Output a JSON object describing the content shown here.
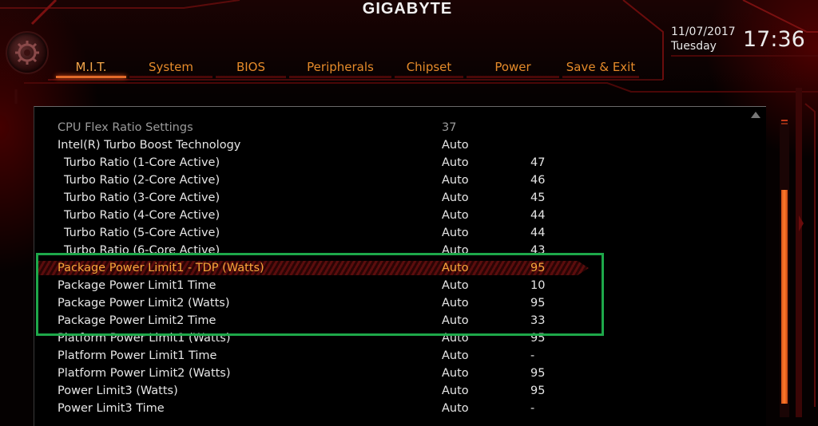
{
  "brand": "GIGABYTE",
  "nav": {
    "tabs": [
      {
        "label": "M.I.T.",
        "active": true
      },
      {
        "label": "System",
        "active": false
      },
      {
        "label": "BIOS",
        "active": false
      },
      {
        "label": "Peripherals",
        "active": false
      },
      {
        "label": "Chipset",
        "active": false
      },
      {
        "label": "Power",
        "active": false
      },
      {
        "label": "Save & Exit",
        "active": false
      }
    ]
  },
  "clock": {
    "date": "11/07/2017",
    "day": "Tuesday",
    "time": "17:36"
  },
  "colors": {
    "accent": "#e26a2a",
    "tab_text": "#e58a2a",
    "selected_text": "#f6a63a",
    "highlight_box": "#1ea84a"
  },
  "settings": [
    {
      "label": "CPU Flex Ratio Settings",
      "value": "37",
      "current": "",
      "indent": false,
      "dim": true,
      "selected": false
    },
    {
      "label": "Intel(R) Turbo Boost Technology",
      "value": "Auto",
      "current": "",
      "indent": false,
      "dim": false,
      "selected": false
    },
    {
      "label": "Turbo Ratio (1-Core Active)",
      "value": "Auto",
      "current": "47",
      "indent": true,
      "dim": false,
      "selected": false
    },
    {
      "label": "Turbo Ratio (2-Core Active)",
      "value": "Auto",
      "current": "46",
      "indent": true,
      "dim": false,
      "selected": false
    },
    {
      "label": "Turbo Ratio (3-Core Active)",
      "value": "Auto",
      "current": "45",
      "indent": true,
      "dim": false,
      "selected": false
    },
    {
      "label": "Turbo Ratio (4-Core Active)",
      "value": "Auto",
      "current": "44",
      "indent": true,
      "dim": false,
      "selected": false
    },
    {
      "label": "Turbo Ratio (5-Core Active)",
      "value": "Auto",
      "current": "44",
      "indent": true,
      "dim": false,
      "selected": false
    },
    {
      "label": "Turbo Ratio (6-Core Active)",
      "value": "Auto",
      "current": "43",
      "indent": true,
      "dim": false,
      "selected": false
    },
    {
      "label": "Package Power Limit1 - TDP (Watts)",
      "value": "Auto",
      "current": "95",
      "indent": false,
      "dim": false,
      "selected": true
    },
    {
      "label": "Package Power Limit1 Time",
      "value": "Auto",
      "current": "10",
      "indent": false,
      "dim": false,
      "selected": false
    },
    {
      "label": "Package Power Limit2 (Watts)",
      "value": "Auto",
      "current": "95",
      "indent": false,
      "dim": false,
      "selected": false
    },
    {
      "label": "Package Power Limit2 Time",
      "value": "Auto",
      "current": "33",
      "indent": false,
      "dim": false,
      "selected": false
    },
    {
      "label": "Platform Power Limit1 (Watts)",
      "value": "Auto",
      "current": "95",
      "indent": false,
      "dim": false,
      "selected": false
    },
    {
      "label": "Platform Power Limit1 Time",
      "value": "Auto",
      "current": "-",
      "indent": false,
      "dim": false,
      "selected": false
    },
    {
      "label": "Platform Power Limit2 (Watts)",
      "value": "Auto",
      "current": "95",
      "indent": false,
      "dim": false,
      "selected": false
    },
    {
      "label": "Power Limit3 (Watts)",
      "value": "Auto",
      "current": "95",
      "indent": false,
      "dim": false,
      "selected": false
    },
    {
      "label": "Power Limit3 Time",
      "value": "Auto",
      "current": "-",
      "indent": false,
      "dim": false,
      "selected": false
    }
  ]
}
